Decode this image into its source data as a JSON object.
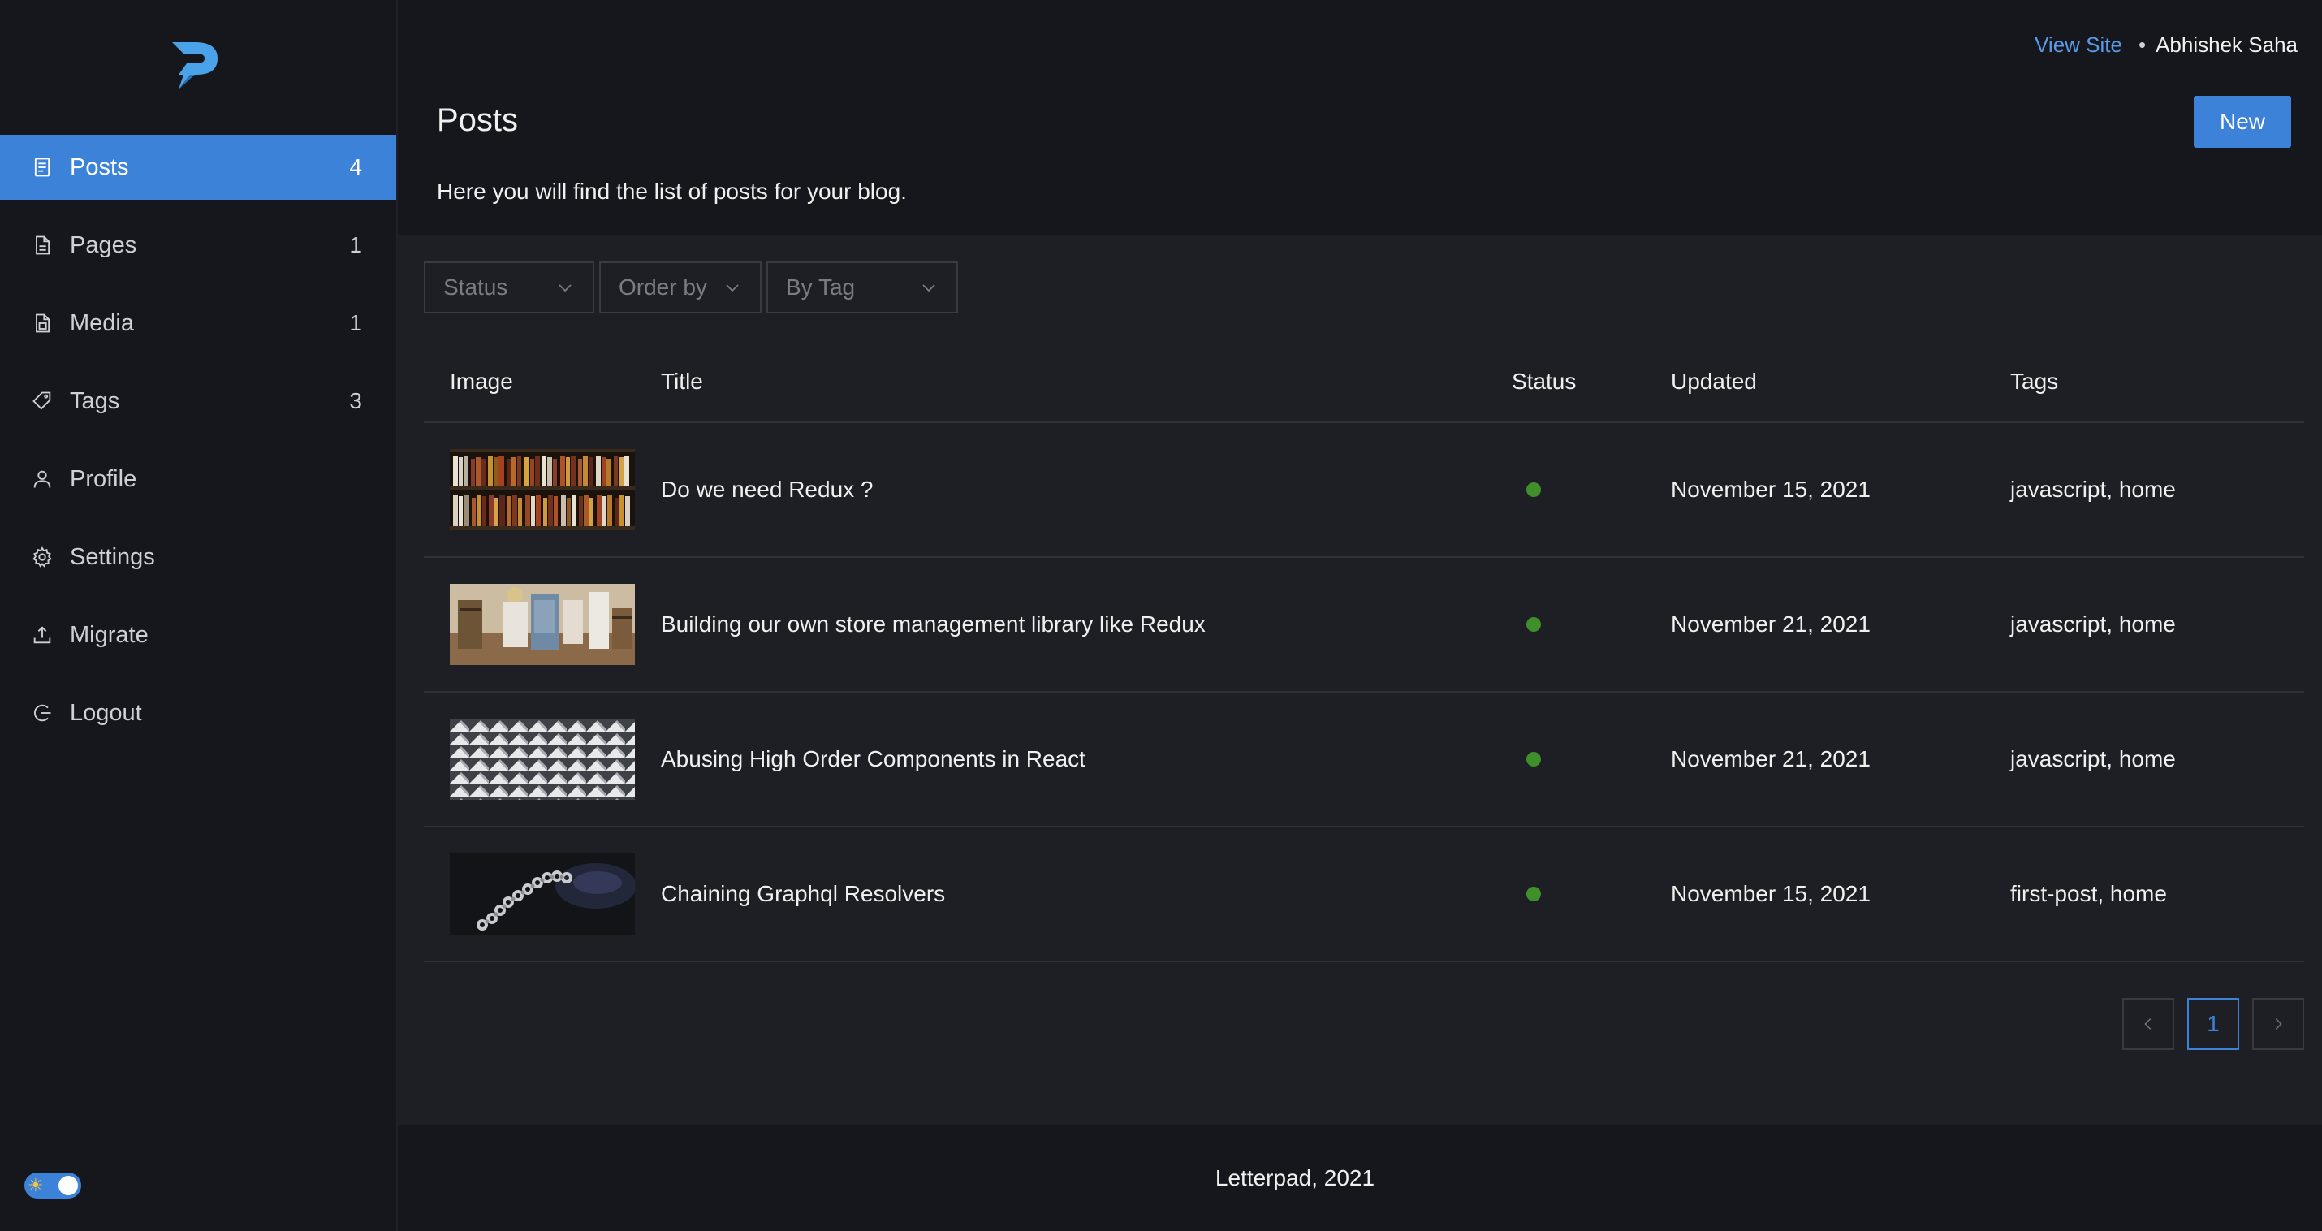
{
  "topbar": {
    "view_site": "View Site",
    "separator": "•",
    "username": "Abhishek Saha"
  },
  "sidebar": {
    "items": [
      {
        "label": "Posts",
        "count": "4",
        "icon": "posts-icon",
        "active": true
      },
      {
        "label": "Pages",
        "count": "1",
        "icon": "pages-icon"
      },
      {
        "label": "Media",
        "count": "1",
        "icon": "media-icon"
      },
      {
        "label": "Tags",
        "count": "3",
        "icon": "tag-icon"
      },
      {
        "label": "Profile",
        "count": "",
        "icon": "user-icon"
      },
      {
        "label": "Settings",
        "count": "",
        "icon": "gear-icon"
      },
      {
        "label": "Migrate",
        "count": "",
        "icon": "upload-icon"
      },
      {
        "label": "Logout",
        "count": "",
        "icon": "logout-icon"
      }
    ],
    "theme_toggle_icon": "sun-icon"
  },
  "header": {
    "title": "Posts",
    "new_label": "New",
    "description": "Here you will find the list of posts for your blog."
  },
  "filters": {
    "status": "Status",
    "order_by": "Order by",
    "by_tag": "By Tag"
  },
  "table": {
    "columns": [
      "Image",
      "Title",
      "Status",
      "Updated",
      "Tags"
    ],
    "rows": [
      {
        "title": "Do we need Redux ?",
        "status": "published",
        "updated": "November 15, 2021",
        "tags": "javascript, home",
        "image": "bookshelf"
      },
      {
        "title": "Building our own store management library like Redux",
        "status": "published",
        "updated": "November 21, 2021",
        "tags": "javascript, home",
        "image": "store"
      },
      {
        "title": "Abusing High Order Components in React",
        "status": "published",
        "updated": "November 21, 2021",
        "tags": "javascript, home",
        "image": "pattern"
      },
      {
        "title": "Chaining Graphql Resolvers",
        "status": "published",
        "updated": "November 15, 2021",
        "tags": "first-post, home",
        "image": "chain"
      }
    ]
  },
  "pagination": {
    "current": "1"
  },
  "footer": {
    "text": "Letterpad, 2021"
  },
  "colors": {
    "accent": "#3b82d8",
    "published": "#3f8f2b",
    "link": "#5b9ae8"
  }
}
